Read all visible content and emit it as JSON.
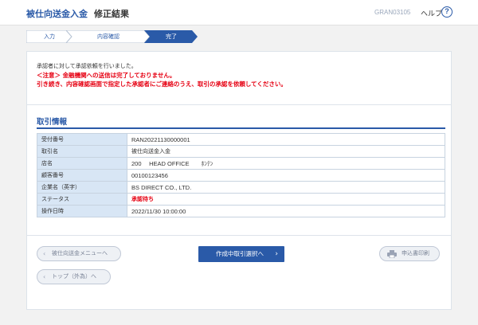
{
  "header": {
    "title": "被仕向送金入金",
    "subtitle": "修正結果",
    "screen_code": "GRAN03105",
    "help_label": "ヘルプ",
    "help_icon_glyph": "?"
  },
  "stepper": {
    "steps": [
      {
        "label": "入力"
      },
      {
        "label": "内容確認"
      },
      {
        "label": "完了",
        "active": true
      }
    ]
  },
  "message": {
    "line1": "承認者に対して承認依頼を行いました。",
    "line2": "＜注意＞ 金融機関への送信は完了しておりません。",
    "line3": "引き続き、内容確認画面で指定した承認者にご連絡のうえ、取引の承認を依頼してください。"
  },
  "section": {
    "title": "取引情報"
  },
  "table": {
    "rows": [
      {
        "label": "受付番号",
        "value": "RAN20221130000001"
      },
      {
        "label": "取引名",
        "value": "被仕向送金入金"
      },
      {
        "label": "店名",
        "value": "200　 HEAD OFFICE　　ﾎﾝﾃﾝ"
      },
      {
        "label": "顧客番号",
        "value": "00100123456"
      },
      {
        "label": "企業名（英字）",
        "value": "BS DIRECT CO., LTD."
      },
      {
        "label": "ステータス",
        "value": "承認待ち"
      },
      {
        "label": "操作日時",
        "value": "2022/11/30 10:00:00"
      }
    ]
  },
  "buttons": {
    "menu_back": "被仕向送金メニューへ",
    "top_back": "トップ（外為）へ",
    "main": "作成中取引選択へ",
    "print": "申込書印刷"
  },
  "colors": {
    "accent": "#2a5aa8",
    "warning": "#e60012",
    "table_label_bg": "#d8e6f5"
  }
}
